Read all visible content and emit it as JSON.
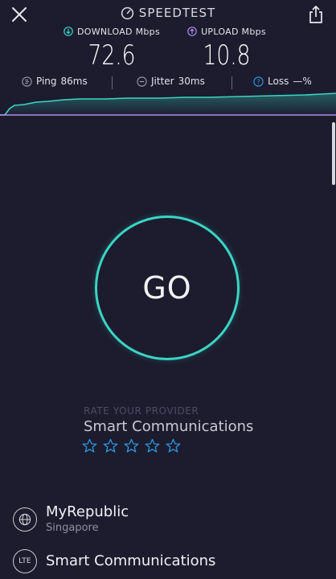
{
  "header": {
    "title": "SPEEDTEST",
    "close_icon": "close-icon",
    "share_icon": "share-icon"
  },
  "metrics": {
    "download": {
      "label": "DOWNLOAD Mbps",
      "value": "72.6",
      "icon": "download-arrow-icon"
    },
    "upload": {
      "label": "UPLOAD Mbps",
      "value": "10.8",
      "icon": "upload-arrow-icon"
    }
  },
  "stats": {
    "ping": {
      "label": "Ping",
      "value": "86ms"
    },
    "jitter": {
      "label": "Jitter",
      "value": "30ms"
    },
    "loss": {
      "label": "Loss",
      "value": "—%"
    }
  },
  "go": {
    "label": "GO"
  },
  "rating": {
    "title": "RATE YOUR PROVIDER",
    "provider": "Smart Communications",
    "stars_total": 5,
    "stars_filled": 0
  },
  "servers": {
    "isp": {
      "name": "MyRepublic",
      "location": "Singapore",
      "icon": "globe-icon"
    },
    "network": {
      "name": "Smart Communications",
      "badge": "LTE"
    }
  },
  "colors": {
    "background": "#1c1c2e",
    "download_accent": "#3ad5c4",
    "upload_accent": "#b58af0",
    "stars": "#2e9be8"
  }
}
